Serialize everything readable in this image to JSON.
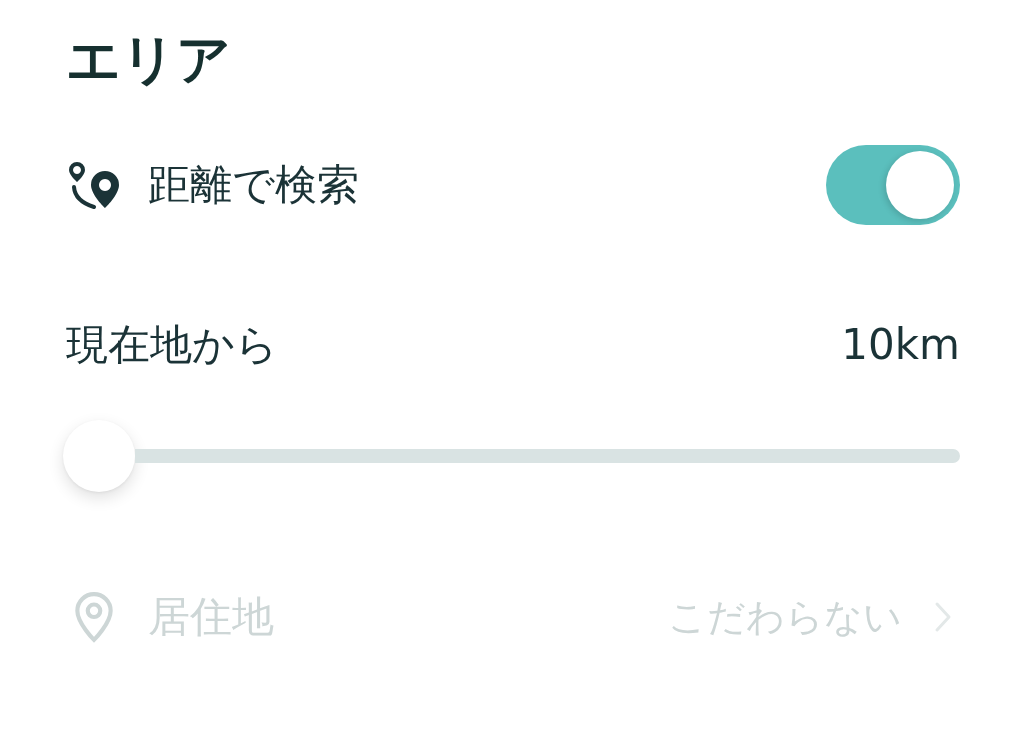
{
  "section": {
    "title": "エリア"
  },
  "distance_search": {
    "label": "距離で検索",
    "on": true
  },
  "range": {
    "label": "現在地から",
    "reading": "10km",
    "level": 0
  },
  "residence": {
    "label": "居住地",
    "value": "こだわらない",
    "disabled": true
  }
}
